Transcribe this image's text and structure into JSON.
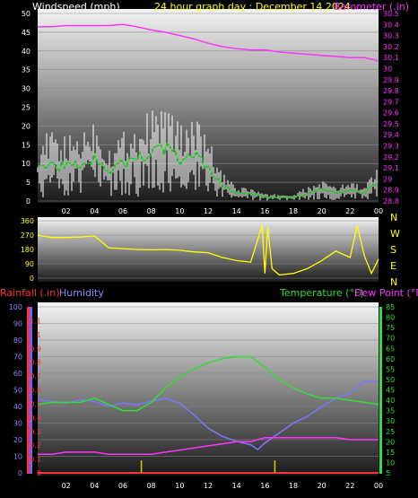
{
  "header": {
    "wind_label": "Windspeed (mph)",
    "graph_title": "24 hour graph day : December 14 2024",
    "baro_label": "Barometer (.in)"
  },
  "lower_header": {
    "rain_label": "Rainfall (.in)",
    "hum_label": "Humidity",
    "temp_label": "Temperature (°F)",
    "dew_label": "Dew Point (°F)"
  },
  "compass": [
    "N",
    "W",
    "S",
    "E",
    "N"
  ],
  "colors": {
    "wind": "#ffffff",
    "wind_avg": "#22cc22",
    "baro": "#ff33ff",
    "direction": "#ffff00",
    "rain": "#ff3333",
    "humidity": "#7777ff",
    "temperature": "#33dd33",
    "dewpoint": "#ff33ff",
    "rain_event": "#cccc00"
  },
  "chart_data": [
    {
      "type": "line",
      "x_ticks": [
        "02",
        "04",
        "06",
        "08",
        "10",
        "12",
        "14",
        "16",
        "18",
        "20",
        "22",
        "00"
      ],
      "wind_ticks": [
        "0",
        "5",
        "10",
        "15",
        "20",
        "25",
        "30",
        "35",
        "40",
        "45",
        "50"
      ],
      "baro_ticks": [
        "28.8",
        "28.9",
        "29",
        "29.1",
        "29.2",
        "29.3",
        "29.4",
        "29.5",
        "29.6",
        "29.7",
        "29.8",
        "29.9",
        "30",
        "30.1",
        "30.2",
        "30.3",
        "30.4",
        "30.5"
      ],
      "ylim_wind": [
        0,
        50
      ],
      "ylim_baro": [
        28.8,
        30.5
      ],
      "series": [
        {
          "name": "Windspeed (mph)",
          "x": [
            0,
            1,
            2,
            3,
            4,
            5,
            6,
            7,
            8,
            9,
            10,
            11,
            12,
            13,
            14,
            15,
            16,
            17,
            18,
            19,
            20,
            21,
            22,
            23,
            24
          ],
          "values": [
            9,
            10,
            9,
            10,
            12,
            8,
            10,
            11,
            13,
            14,
            11,
            12,
            9,
            4,
            2,
            2,
            1,
            1,
            1,
            2,
            3,
            2,
            3,
            2,
            5
          ]
        },
        {
          "name": "Barometer (.in)",
          "x": [
            0,
            1,
            2,
            3,
            4,
            5,
            6,
            7,
            8,
            9,
            10,
            11,
            12,
            13,
            14,
            15,
            16,
            17,
            18,
            19,
            20,
            21,
            22,
            23,
            24
          ],
          "values": [
            30.38,
            30.38,
            30.39,
            30.39,
            30.39,
            30.39,
            30.4,
            30.38,
            30.35,
            30.33,
            30.3,
            30.27,
            30.23,
            30.2,
            30.18,
            30.17,
            30.17,
            30.15,
            30.14,
            30.13,
            30.12,
            30.11,
            30.1,
            30.1,
            30.07
          ]
        }
      ]
    },
    {
      "type": "line",
      "y_ticks": [
        "0",
        "90",
        "180",
        "270",
        "360"
      ],
      "ylim": [
        0,
        360
      ],
      "series": [
        {
          "name": "Wind Direction",
          "x": [
            0,
            1,
            2,
            3,
            4,
            5,
            6,
            7,
            8,
            9,
            10,
            11,
            12,
            13,
            14,
            15,
            15.8,
            16,
            16.2,
            16.5,
            17,
            18,
            19,
            20,
            21,
            22,
            22.5,
            23,
            23.5,
            24
          ],
          "values": [
            270,
            255,
            255,
            258,
            265,
            190,
            185,
            180,
            178,
            180,
            175,
            165,
            160,
            130,
            110,
            100,
            330,
            30,
            320,
            60,
            20,
            30,
            60,
            110,
            170,
            130,
            330,
            140,
            30,
            120
          ]
        }
      ]
    },
    {
      "type": "line",
      "rain_ticks": [
        "0",
        "0.1",
        "0.2",
        "0.3",
        "0.4",
        "0.5",
        "0.6",
        "0.7",
        "0.8",
        "0.9",
        "1",
        "1.1"
      ],
      "hum_ticks": [
        "0",
        "10",
        "20",
        "30",
        "40",
        "50",
        "60",
        "70",
        "80",
        "90",
        "100"
      ],
      "temp_ticks": [
        "5",
        "10",
        "15",
        "20",
        "25",
        "30",
        "35",
        "40",
        "45",
        "50",
        "55",
        "60",
        "65",
        "70",
        "75",
        "80",
        "85"
      ],
      "ylim_rain": [
        0,
        1.2
      ],
      "ylim_humidity": [
        0,
        100
      ],
      "ylim_temp": [
        5,
        85
      ],
      "series": [
        {
          "name": "Humidity",
          "x": [
            0,
            1,
            2,
            3,
            4,
            5,
            6,
            7,
            8,
            9,
            10,
            11,
            12,
            13,
            14,
            15,
            15.5,
            16,
            17,
            18,
            19,
            20,
            21,
            22,
            23,
            24
          ],
          "values": [
            44,
            43,
            42,
            44,
            43,
            40,
            42,
            41,
            43,
            45,
            42,
            35,
            27,
            22,
            19,
            17,
            14,
            18,
            24,
            30,
            34,
            40,
            45,
            48,
            55,
            55
          ]
        },
        {
          "name": "Temperature (°F)",
          "x": [
            0,
            1,
            2,
            3,
            4,
            5,
            6,
            7,
            8,
            9,
            10,
            11,
            12,
            13,
            14,
            15,
            16,
            17,
            18,
            19,
            20,
            21,
            22,
            23,
            24
          ],
          "values": [
            38,
            39,
            39,
            39,
            41,
            38,
            35,
            35,
            39,
            46,
            51,
            55,
            58,
            60,
            61,
            61,
            56,
            50,
            46,
            43,
            41,
            41,
            40,
            39,
            38
          ]
        },
        {
          "name": "Dew Point (°F)",
          "x": [
            0,
            1,
            2,
            3,
            4,
            5,
            6,
            7,
            8,
            9,
            10,
            11,
            12,
            13,
            14,
            15,
            16,
            17,
            18,
            19,
            20,
            21,
            22,
            23,
            24
          ],
          "values": [
            14,
            14,
            15,
            15,
            15,
            14,
            14,
            14,
            14,
            15,
            16,
            17,
            18,
            19,
            20,
            20,
            22,
            22,
            22,
            22,
            22,
            22,
            21,
            21,
            21
          ]
        },
        {
          "name": "Rainfall (.in)",
          "x": [
            0,
            24
          ],
          "values": [
            0,
            0
          ]
        }
      ],
      "rain_events": [
        7.3,
        16.7
      ]
    }
  ]
}
